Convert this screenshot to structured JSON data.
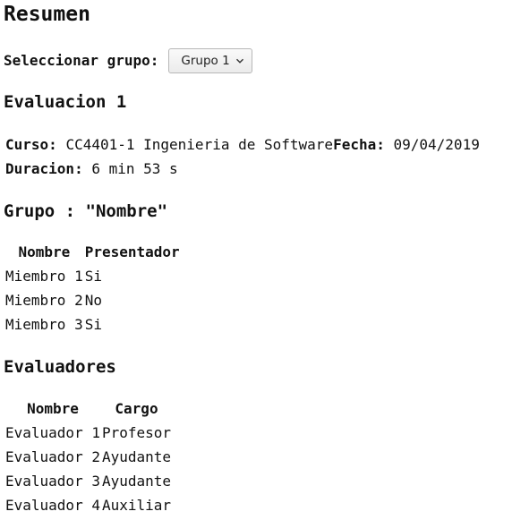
{
  "page": {
    "title": "Resumen"
  },
  "group_select": {
    "label": "Seleccionar grupo:",
    "selected": "Grupo 1"
  },
  "evaluation": {
    "title": "Evaluacion 1",
    "curso_label": "Curso:",
    "curso_value": "CC4401-1 Ingenieria de Software",
    "fecha_label": "Fecha:",
    "fecha_value": "09/04/2019",
    "duracion_label": "Duracion:",
    "duracion_value": "6 min 53 s"
  },
  "group": {
    "title": "Grupo : \"Nombre\"",
    "headers": [
      "Nombre",
      "Presentador"
    ],
    "rows": [
      [
        "Miembro 1",
        "Si"
      ],
      [
        "Miembro 2",
        "No"
      ],
      [
        "Miembro 3",
        "Si"
      ]
    ]
  },
  "evaluators": {
    "title": "Evaluadores",
    "headers": [
      "Nombre",
      "Cargo"
    ],
    "rows": [
      [
        "Evaluador 1",
        "Profesor"
      ],
      [
        "Evaluador 2",
        "Ayudante"
      ],
      [
        "Evaluador 3",
        "Ayudante"
      ],
      [
        "Evaluador 4",
        "Auxiliar"
      ]
    ]
  }
}
